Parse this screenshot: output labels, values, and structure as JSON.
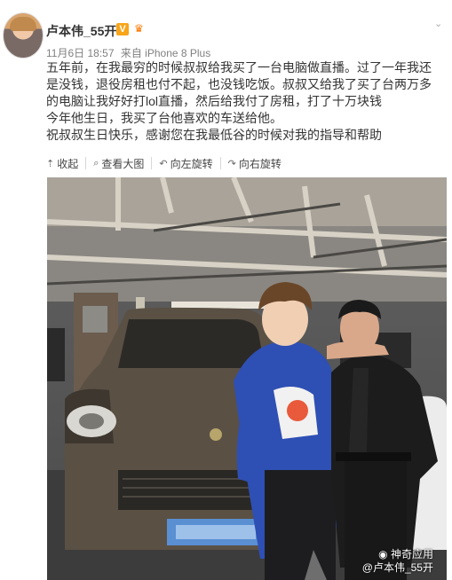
{
  "author": {
    "name": "卢本伟_55开",
    "vip_badge": "V"
  },
  "meta": {
    "date": "11月6日 18:57",
    "source": "来自 iPhone 8 Plus"
  },
  "post": {
    "lines": [
      "五年前，在我最穷的时候叔叔给我买了一台电脑做直播。过了一年我还是没钱，退役房租也付不起，也没钱吃饭。叔叔又给我了买了台两万多的电脑让我好好打lol直播，然后给我付了房租，打了十万块钱",
      "今年他生日，我买了台他喜欢的车送给他。",
      "祝叔叔生日快乐，感谢您在我最低谷的时候对我的指导和帮助"
    ]
  },
  "actions": {
    "collapse": "收起",
    "view_large": "查看大图",
    "rotate_left": "向左旋转",
    "rotate_right": "向右旋转"
  },
  "watermark": {
    "brand": "神奇应用",
    "handle": "@卢本伟_55开"
  },
  "colors": {
    "vip": "#f8a51a",
    "crown": "#ff7800",
    "shirt": "#2e4fb4",
    "car": "#5a5044"
  },
  "icons": [
    "chevron-down-icon",
    "collapse-icon",
    "zoom-icon",
    "rotate-left-icon",
    "rotate-right-icon",
    "crown-icon",
    "weibo-eye-icon"
  ]
}
